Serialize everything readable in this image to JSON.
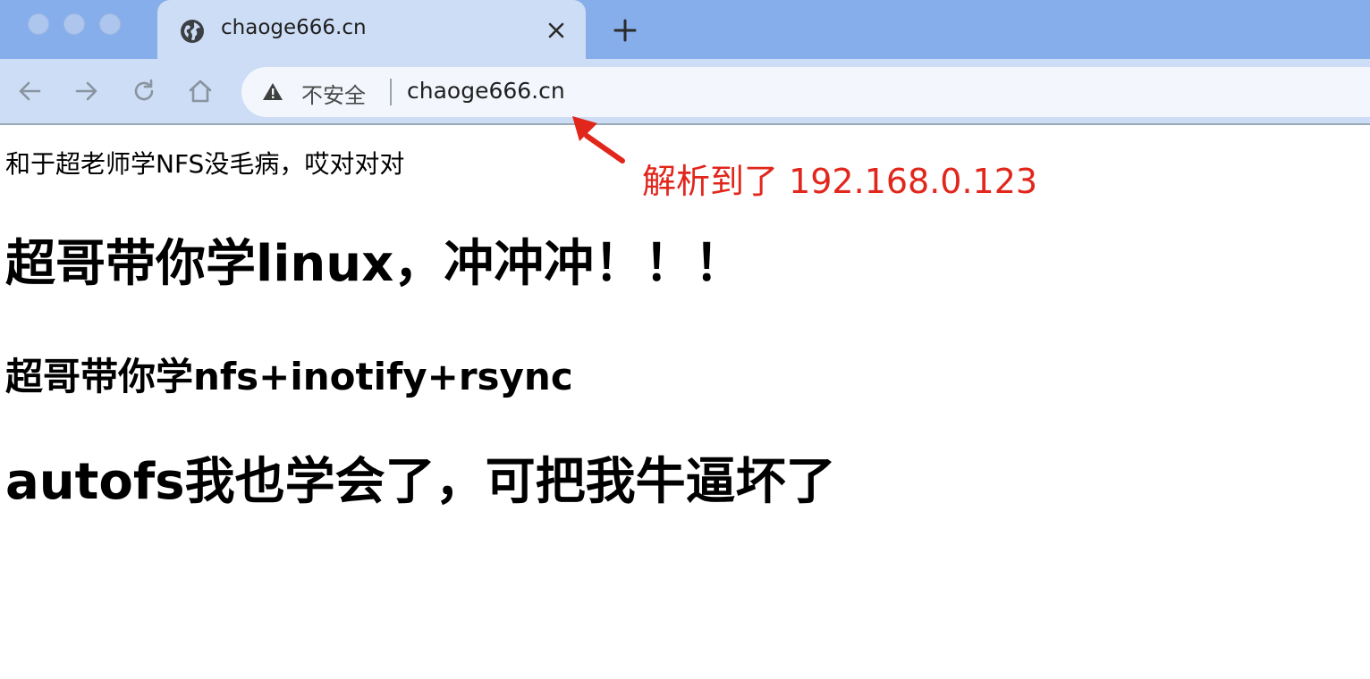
{
  "browser": {
    "tab": {
      "title": "chaoge666.cn",
      "favicon": "globe-icon",
      "close_icon": "close-icon"
    },
    "new_tab_icon": "plus-icon",
    "toolbar": {
      "back_icon": "arrow-left-icon",
      "forward_icon": "arrow-right-icon",
      "reload_icon": "reload-icon",
      "home_icon": "home-icon"
    },
    "omnibox": {
      "security_icon": "warning-icon",
      "security_label": "不安全",
      "url": "chaoge666.cn"
    },
    "colors": {
      "tabstrip": "#86aeea",
      "toolbar": "#ccddf5",
      "annotation": "#e1261c"
    }
  },
  "page": {
    "paragraph": "和于超老师学NFS没毛病，哎对对对",
    "heading1": "超哥带你学linux，冲冲冲！！！",
    "heading2": "超哥带你学nfs+inotify+rsync",
    "heading3": "autofs我也学会了，可把我牛逼坏了"
  },
  "annotation": {
    "text": "解析到了 192.168.0.123"
  }
}
